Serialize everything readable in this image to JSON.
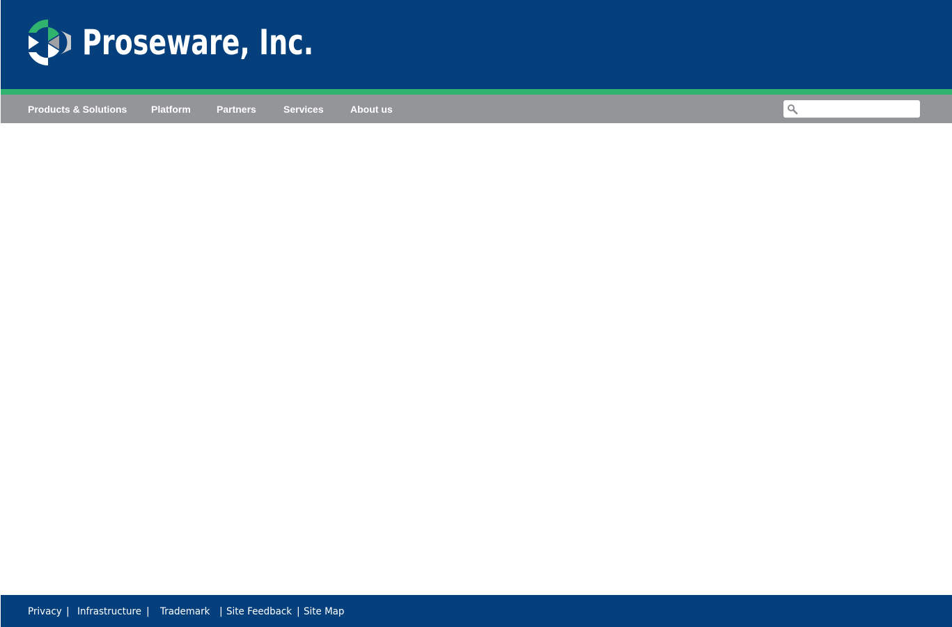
{
  "brand": {
    "name": "Proseware, Inc.",
    "logo_icon": "proseware-logo-icon",
    "colors": {
      "header_bg": "#05407d",
      "accent": "#2fb36e",
      "nav_bg": "#939598",
      "text": "#ffffff"
    }
  },
  "nav": {
    "items": [
      {
        "label": "Products & Solutions"
      },
      {
        "label": "Platform"
      },
      {
        "label": "Partners"
      },
      {
        "label": "Services"
      },
      {
        "label": "About us"
      }
    ]
  },
  "search": {
    "icon": "search-icon",
    "value": "",
    "placeholder": ""
  },
  "footer": {
    "links": [
      {
        "label": "Privacy"
      },
      {
        "label": "Infrastructure"
      },
      {
        "label": "Trademark"
      },
      {
        "label": "Site Feedback"
      },
      {
        "label": "Site Map"
      }
    ],
    "separator": "|"
  }
}
